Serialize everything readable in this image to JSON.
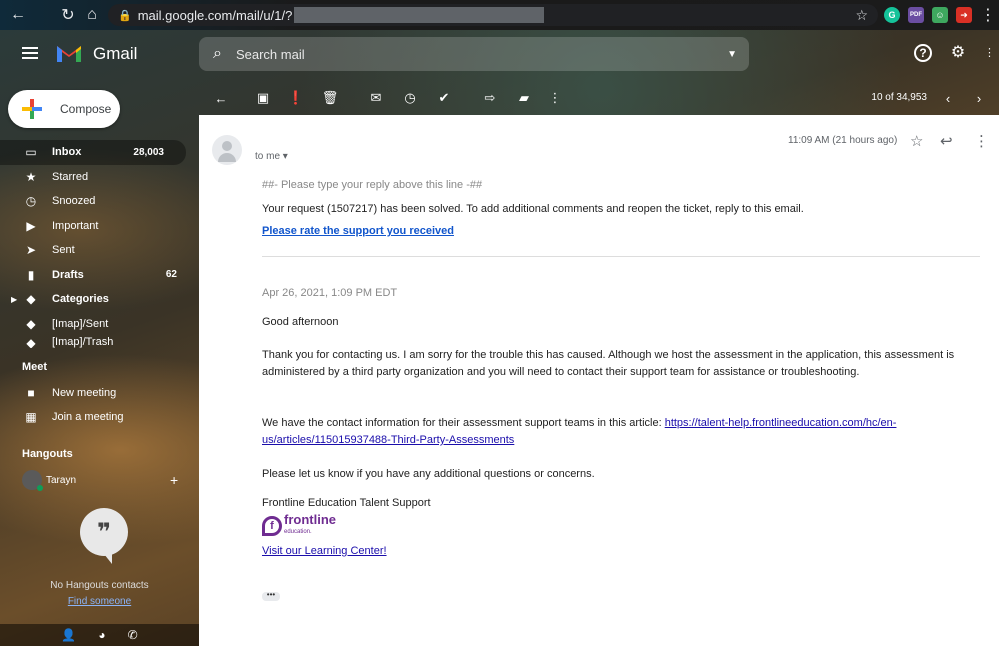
{
  "browser": {
    "url": "mail.google.com/mail/u/1/?",
    "extensions": [
      {
        "name": "grammarly-icon",
        "color": "#15c39a",
        "glyph": "G"
      },
      {
        "name": "pdf-icon",
        "color": "#6b4ea2",
        "glyph": "PDF"
      },
      {
        "name": "smile-icon",
        "color": "#3ea85f",
        "glyph": "☺"
      },
      {
        "name": "arrow-badge-icon",
        "color": "#d93025",
        "glyph": "➜"
      }
    ]
  },
  "app": {
    "brand": "Gmail"
  },
  "search": {
    "placeholder": "Search mail"
  },
  "toolbar": {
    "count": "10 of 34,953"
  },
  "compose": {
    "label": "Compose"
  },
  "sidebar": {
    "items": [
      {
        "label": "Inbox",
        "count": "28,003",
        "icon": "inbox-icon",
        "glyph": "▭",
        "bold": true,
        "active": true
      },
      {
        "label": "Starred",
        "count": "",
        "icon": "star-icon",
        "glyph": "★",
        "bold": false
      },
      {
        "label": "Snoozed",
        "count": "",
        "icon": "clock-icon",
        "glyph": "◷",
        "bold": false
      },
      {
        "label": "Important",
        "count": "",
        "icon": "important-icon",
        "glyph": "▶",
        "bold": false
      },
      {
        "label": "Sent",
        "count": "",
        "icon": "send-icon",
        "glyph": "➤",
        "bold": false
      },
      {
        "label": "Drafts",
        "count": "62",
        "icon": "draft-icon",
        "glyph": "▮",
        "bold": true
      },
      {
        "label": "Categories",
        "count": "",
        "icon": "label-icon",
        "glyph": "◆",
        "bold": true
      },
      {
        "label": "[Imap]/Sent",
        "count": "",
        "icon": "label-icon",
        "glyph": "◆",
        "bold": false
      },
      {
        "label": "[Imap]/Trash",
        "count": "",
        "icon": "label-icon",
        "glyph": "◆",
        "bold": false
      }
    ],
    "meet_title": "Meet",
    "meet_items": [
      {
        "label": "New meeting",
        "icon": "video-icon",
        "glyph": "■"
      },
      {
        "label": "Join a meeting",
        "icon": "keyboard-icon",
        "glyph": "▦"
      }
    ],
    "hangouts_title": "Hangouts",
    "hangouts_user": "Tarayn",
    "no_contacts": "No Hangouts contacts",
    "find_someone": "Find someone"
  },
  "email": {
    "to": "to me",
    "time": "11:09 AM (21 hours ago)",
    "reply_line": "##- Please type your reply above this line -##",
    "solved": "Your request (1507217) has been solved. To add additional comments and reopen the ticket, reply to this email.",
    "rate_link": "Please rate the support you received",
    "date": "Apr 26, 2021, 1:09 PM EDT",
    "greeting": "Good afternoon",
    "para1": "Thank you for contacting us. I am sorry for the trouble this has caused. Although we host the assessment in the application, this assessment is administered by a third party organization and you will need to contact their support team for assistance or troubleshooting.",
    "para2_prefix": "We have the contact information for their assessment support teams in this article: ",
    "para2_link": "https://talent-help.frontlineeducation.com/hc/en-us/articles/115015937488-Third-Party-Assessments",
    "para3": "Please let us know if you have any additional questions or concerns.",
    "signature": "Frontline Education Talent Support",
    "logo_word": "frontline",
    "logo_sub": "education.",
    "learning_link": "Visit our Learning Center!"
  }
}
